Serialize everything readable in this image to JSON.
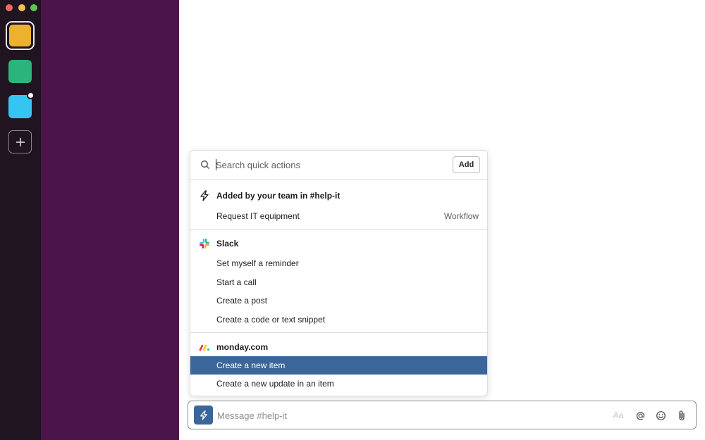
{
  "rail": {
    "workspaces": [
      {
        "name": "workspace-1",
        "color": "#ecb22e",
        "active": true
      },
      {
        "name": "workspace-2",
        "color": "#2bb57c"
      },
      {
        "name": "workspace-3",
        "color": "#36c5f0",
        "has_notification": true
      }
    ],
    "add_icon": "plus-icon"
  },
  "quick_actions": {
    "search_placeholder": "Search quick actions",
    "add_label": "Add",
    "sections": [
      {
        "icon": "lightning-icon",
        "title": "Added by your team in #help-it",
        "items": [
          {
            "label": "Request IT equipment",
            "meta": "Workflow"
          }
        ]
      },
      {
        "icon": "slack-logo-icon",
        "title": "Slack",
        "items": [
          {
            "label": "Set myself a reminder"
          },
          {
            "label": "Start a call"
          },
          {
            "label": "Create a post"
          },
          {
            "label": "Create a code or text snippet"
          }
        ]
      },
      {
        "icon": "monday-logo-icon",
        "title": "monday.com",
        "items": [
          {
            "label": "Create a new item",
            "selected": true
          },
          {
            "label": "Create a new update in an item"
          }
        ]
      }
    ]
  },
  "composer": {
    "placeholder": "Message #help-it",
    "format_label": "Aa",
    "accent": "#3a6699"
  }
}
